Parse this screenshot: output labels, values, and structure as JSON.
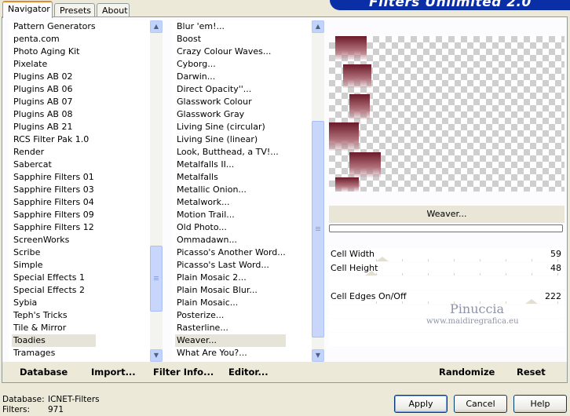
{
  "tabs": [
    {
      "label": "Navigator",
      "active": true
    },
    {
      "label": "Presets",
      "active": false
    },
    {
      "label": "About",
      "active": false
    }
  ],
  "banner_title": "Filters Unlimited 2.0",
  "categories": [
    "Pattern Generators",
    "penta.com",
    "Photo Aging Kit",
    "Pixelate",
    "Plugins AB 02",
    "Plugins AB 06",
    "Plugins AB 07",
    "Plugins AB 08",
    "Plugins AB 21",
    "RCS Filter Pak 1.0",
    "Render",
    "Sabercat",
    "Sapphire Filters 01",
    "Sapphire Filters 03",
    "Sapphire Filters 04",
    "Sapphire Filters 09",
    "Sapphire Filters 12",
    "ScreenWorks",
    "Scribe",
    "Simple",
    "Special Effects 1",
    "Special Effects 2",
    "Sybia",
    "Teph's Tricks",
    "Tile & Mirror",
    "Toadies",
    "Tramages"
  ],
  "selected_category": "Toadies",
  "filters": [
    "Blur 'em!...",
    "Boost",
    "Crazy Colour Waves...",
    "Cyborg...",
    "Darwin...",
    "Direct Opacity''...",
    "Glasswork Colour",
    "Glasswork Gray",
    "Living Sine (circular)",
    "Living Sine (linear)",
    "Look, Butthead, a TV!...",
    "Metalfalls II...",
    "Metalfalls",
    "Metallic Onion...",
    "Metalwork...",
    "Motion Trail...",
    "Old Photo...",
    "Ommadawn...",
    "Picasso's Another Word...",
    "Picasso's Last Word...",
    "Plain Mosaic 2...",
    "Plain Mosaic Blur...",
    "Plain Mosaic...",
    "Posterize...",
    "Rasterline...",
    "Weaver...",
    "What Are You?..."
  ],
  "selected_filter": "Weaver...",
  "filter_name": "Weaver...",
  "params": [
    {
      "label": "Cell Width",
      "value": "59"
    },
    {
      "label": "Cell Height",
      "value": "48"
    },
    {
      "label": "Cell Edges On/Off",
      "value": "222"
    }
  ],
  "watermark": {
    "name": "Pinuccia",
    "url": "www.maidiregrafica.eu"
  },
  "action_buttons": {
    "database": "Database",
    "import": "Import...",
    "filter_info": "Filter Info...",
    "editor": "Editor...",
    "randomize": "Randomize",
    "reset": "Reset"
  },
  "status": {
    "database_label": "Database:",
    "database_value": "ICNET-Filters",
    "filters_label": "Filters:",
    "filters_value": "971"
  },
  "dialog_buttons": {
    "apply": "Apply",
    "cancel": "Cancel",
    "help": "Help"
  },
  "colors": {
    "accent": "#e68b2c",
    "banner": "#0a2ea6",
    "scroll": "#c1d3fb"
  }
}
